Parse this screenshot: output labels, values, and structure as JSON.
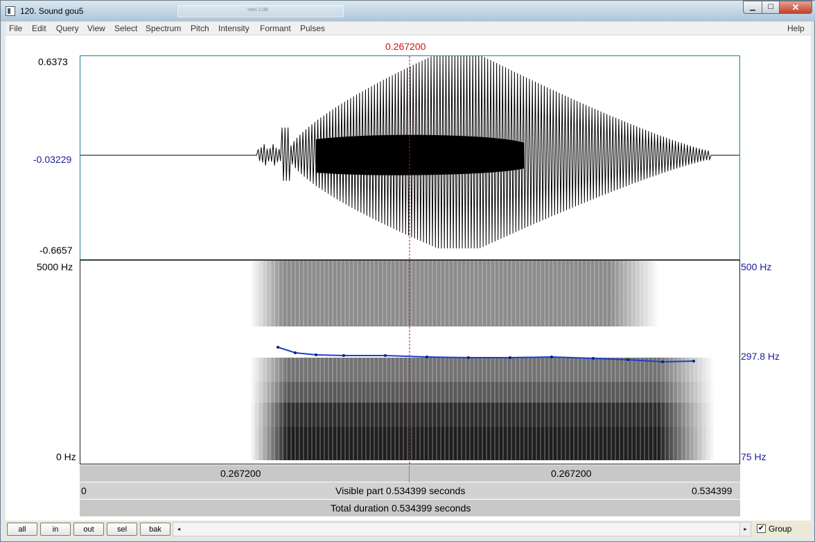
{
  "window": {
    "title": "120. Sound gou5",
    "ghost_title": "Vein 2.0B"
  },
  "window_controls": {
    "minimize": "▁",
    "maximize": "☐",
    "close": "✕"
  },
  "menu": {
    "items": [
      "File",
      "Edit",
      "Query",
      "View",
      "Select",
      "Spectrum",
      "Pitch",
      "Intensity",
      "Formant",
      "Pulses"
    ],
    "help": "Help"
  },
  "cursor": {
    "time_label": "0.267200",
    "color": "#d01010"
  },
  "waveform": {
    "y_max_label": "0.6373",
    "y_zero_label": "-0.03229",
    "y_min_label": "-0.6657"
  },
  "spectrogram": {
    "freq_max_label": "5000 Hz",
    "freq_min_label": "0 Hz",
    "pitch_max_label": "500 Hz",
    "pitch_cursor_label": "297.8 Hz",
    "pitch_min_label": "75 Hz",
    "pitch_color": "#1a3fd0"
  },
  "time_bars": {
    "left_segment_label": "0.267200",
    "right_segment_label": "0.267200",
    "visible_start": "0",
    "visible_part_label": "Visible part 0.534399 seconds",
    "visible_end": "0.534399",
    "total_duration_label": "Total duration 0.534399 seconds"
  },
  "buttons": {
    "all": "all",
    "in": "in",
    "out": "out",
    "sel": "sel",
    "bak": "bak"
  },
  "scroll": {
    "left_arrow": "◂",
    "right_arrow": "▸"
  },
  "group": {
    "checked": "✔",
    "label": "Group"
  }
}
